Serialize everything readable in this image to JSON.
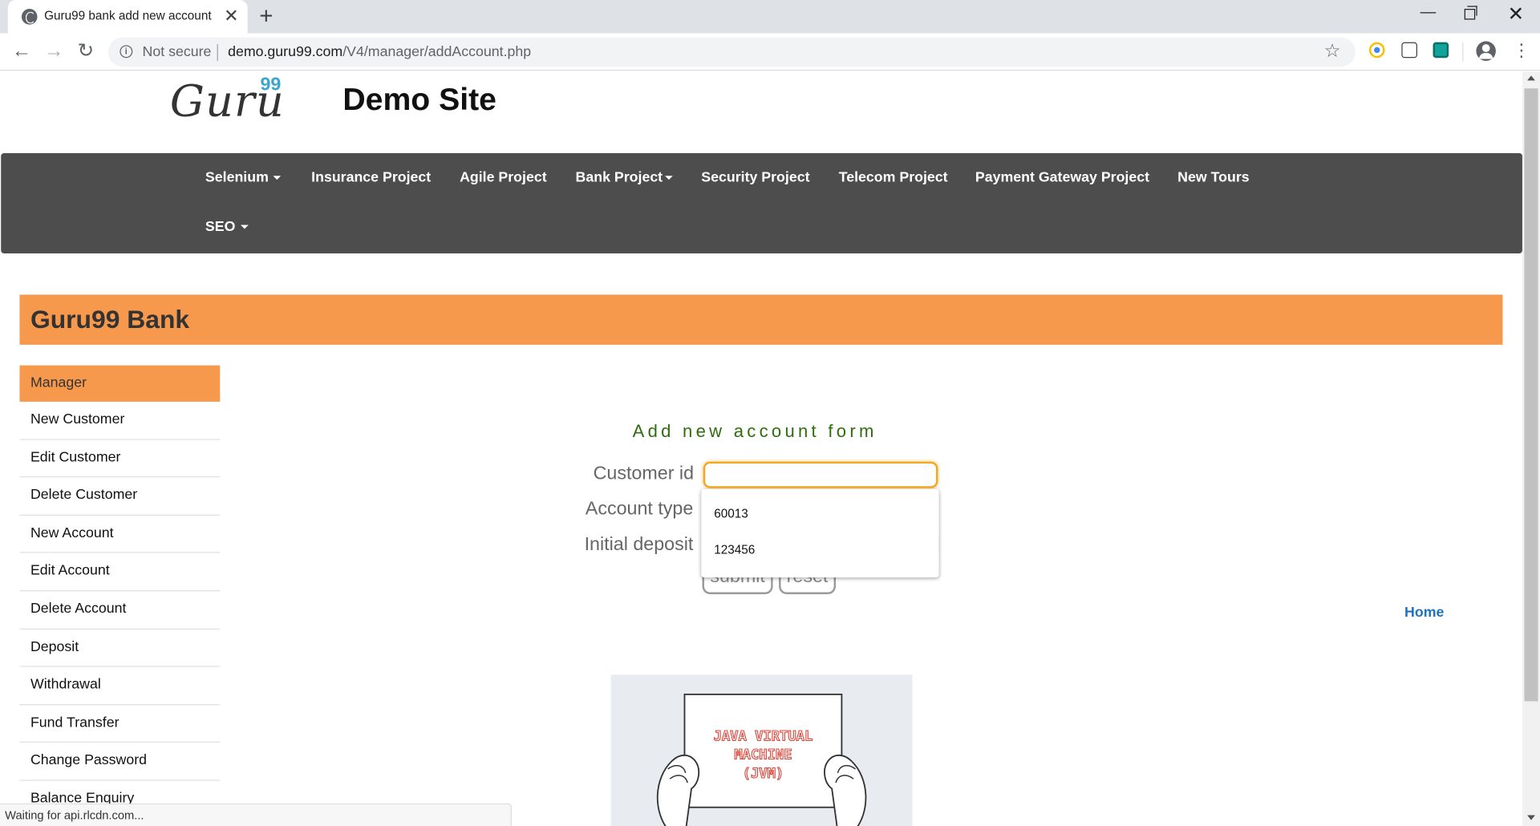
{
  "browser": {
    "tab_title": "Guru99 bank add new account",
    "tab_close": "✕",
    "new_tab": "+",
    "not_secure": "Not secure",
    "url_host": "demo.guru99.com",
    "url_path": "/V4/manager/addAccount.php",
    "status": "Waiting for api.rlcdn.com..."
  },
  "header": {
    "logo_text": "Guru",
    "logo_sup": "99",
    "site_title": "Demo Site"
  },
  "nav": {
    "items": [
      {
        "label": "Selenium",
        "dropdown": true
      },
      {
        "label": "Insurance Project",
        "dropdown": false
      },
      {
        "label": "Agile Project",
        "dropdown": false
      },
      {
        "label": "Bank Project",
        "dropdown": true
      },
      {
        "label": "Security Project",
        "dropdown": false
      },
      {
        "label": "Telecom Project",
        "dropdown": false
      },
      {
        "label": "Payment Gateway Project",
        "dropdown": false
      },
      {
        "label": "New Tours",
        "dropdown": false
      },
      {
        "label": "SEO",
        "dropdown": true
      }
    ]
  },
  "bank": {
    "title": "Guru99 Bank",
    "accent_color": "#f7994c"
  },
  "sidebar": {
    "items": [
      {
        "label": "Manager",
        "active": true
      },
      {
        "label": "New Customer"
      },
      {
        "label": "Edit Customer"
      },
      {
        "label": "Delete Customer"
      },
      {
        "label": "New Account"
      },
      {
        "label": "Edit Account"
      },
      {
        "label": "Delete Account"
      },
      {
        "label": "Deposit"
      },
      {
        "label": "Withdrawal"
      },
      {
        "label": "Fund Transfer"
      },
      {
        "label": "Change Password"
      },
      {
        "label": "Balance Enquiry"
      }
    ]
  },
  "form": {
    "title": "Add new account form",
    "customer_id_label": "Customer id",
    "customer_id_value": "",
    "account_type_label": "Account type",
    "initial_deposit_label": "Initial deposit",
    "submit_label": "submit",
    "reset_label": "reset",
    "autocomplete_options": [
      "60013",
      "123456"
    ]
  },
  "home_link": "Home",
  "image": {
    "sign_lines": [
      "JAVA VIRTUAL",
      "MACHINE",
      "(JVM)"
    ]
  }
}
